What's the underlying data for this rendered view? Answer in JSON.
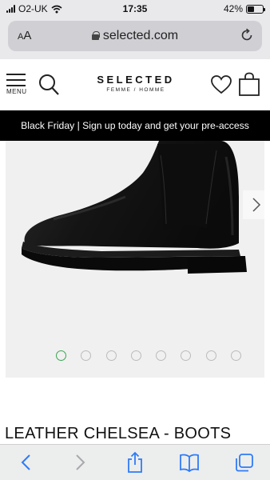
{
  "status_bar": {
    "carrier": "O2-UK",
    "time": "17:35",
    "battery_text": "42%",
    "battery_level": 0.42
  },
  "browser": {
    "text_size_label": "AA",
    "url": "selected.com"
  },
  "header": {
    "menu_label": "MENU",
    "brand_name": "SELECTED",
    "brand_sub": "FEMME / HOMME"
  },
  "promo": {
    "text": "Black Friday | Sign up today and get your pre-access"
  },
  "gallery": {
    "image_count": 8,
    "active_index": 0,
    "accent_color": "#3aa655"
  },
  "product": {
    "title": "LEATHER CHELSEA - BOOTS"
  },
  "icons": [
    "wifi-icon",
    "lock-icon",
    "reload-icon",
    "menu-icon",
    "search-icon",
    "wishlist-heart-icon",
    "shopping-bag-icon",
    "chevron-right-icon",
    "back-arrow-icon",
    "forward-arrow-icon",
    "share-icon",
    "bookmarks-icon",
    "tabs-icon"
  ]
}
